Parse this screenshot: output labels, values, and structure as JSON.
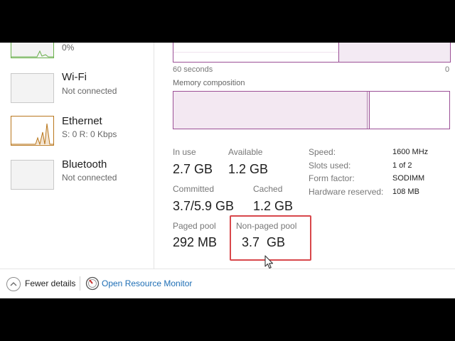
{
  "sidebar": {
    "items": [
      {
        "title": "",
        "subtitle": "0%"
      },
      {
        "title": "Wi-Fi",
        "subtitle": "Not connected"
      },
      {
        "title": "Ethernet",
        "subtitle": "S: 0 R: 0 Kbps"
      },
      {
        "title": "Bluetooth",
        "subtitle": "Not connected"
      }
    ]
  },
  "graph": {
    "x_axis_left": "60 seconds",
    "x_axis_right": "0"
  },
  "memory_composition": {
    "label": "Memory composition"
  },
  "stats": {
    "in_use": {
      "label": "In use",
      "value": "2.7 GB"
    },
    "available": {
      "label": "Available",
      "value": "1.2 GB"
    },
    "committed": {
      "label": "Committed",
      "value": "3.7/5.9 GB"
    },
    "cached": {
      "label": "Cached",
      "value": "1.2 GB"
    },
    "paged_pool": {
      "label": "Paged pool",
      "value": "292 MB"
    },
    "non_paged_pool": {
      "label": "Non-paged pool",
      "value": "3.7  GB"
    }
  },
  "specs": {
    "speed": {
      "label": "Speed:",
      "value": "1600 MHz"
    },
    "slots_used": {
      "label": "Slots used:",
      "value": "1 of 2"
    },
    "form_factor": {
      "label": "Form factor:",
      "value": "SODIMM"
    },
    "hardware_reserved": {
      "label": "Hardware reserved:",
      "value": "108 MB"
    }
  },
  "footer": {
    "fewer_details": "Fewer details",
    "open_resource_monitor": "Open Resource Monitor"
  },
  "colors": {
    "memory_accent": "#9b4f96",
    "highlight": "#d8474b",
    "link": "#1e6eb5",
    "ethernet_accent": "#b9771d",
    "cpu_accent": "#6ab04c"
  },
  "icons": {
    "fewer_details": "chevron-up-icon",
    "resource_monitor": "resource-monitor-icon",
    "cursor": "mouse-pointer-icon"
  }
}
